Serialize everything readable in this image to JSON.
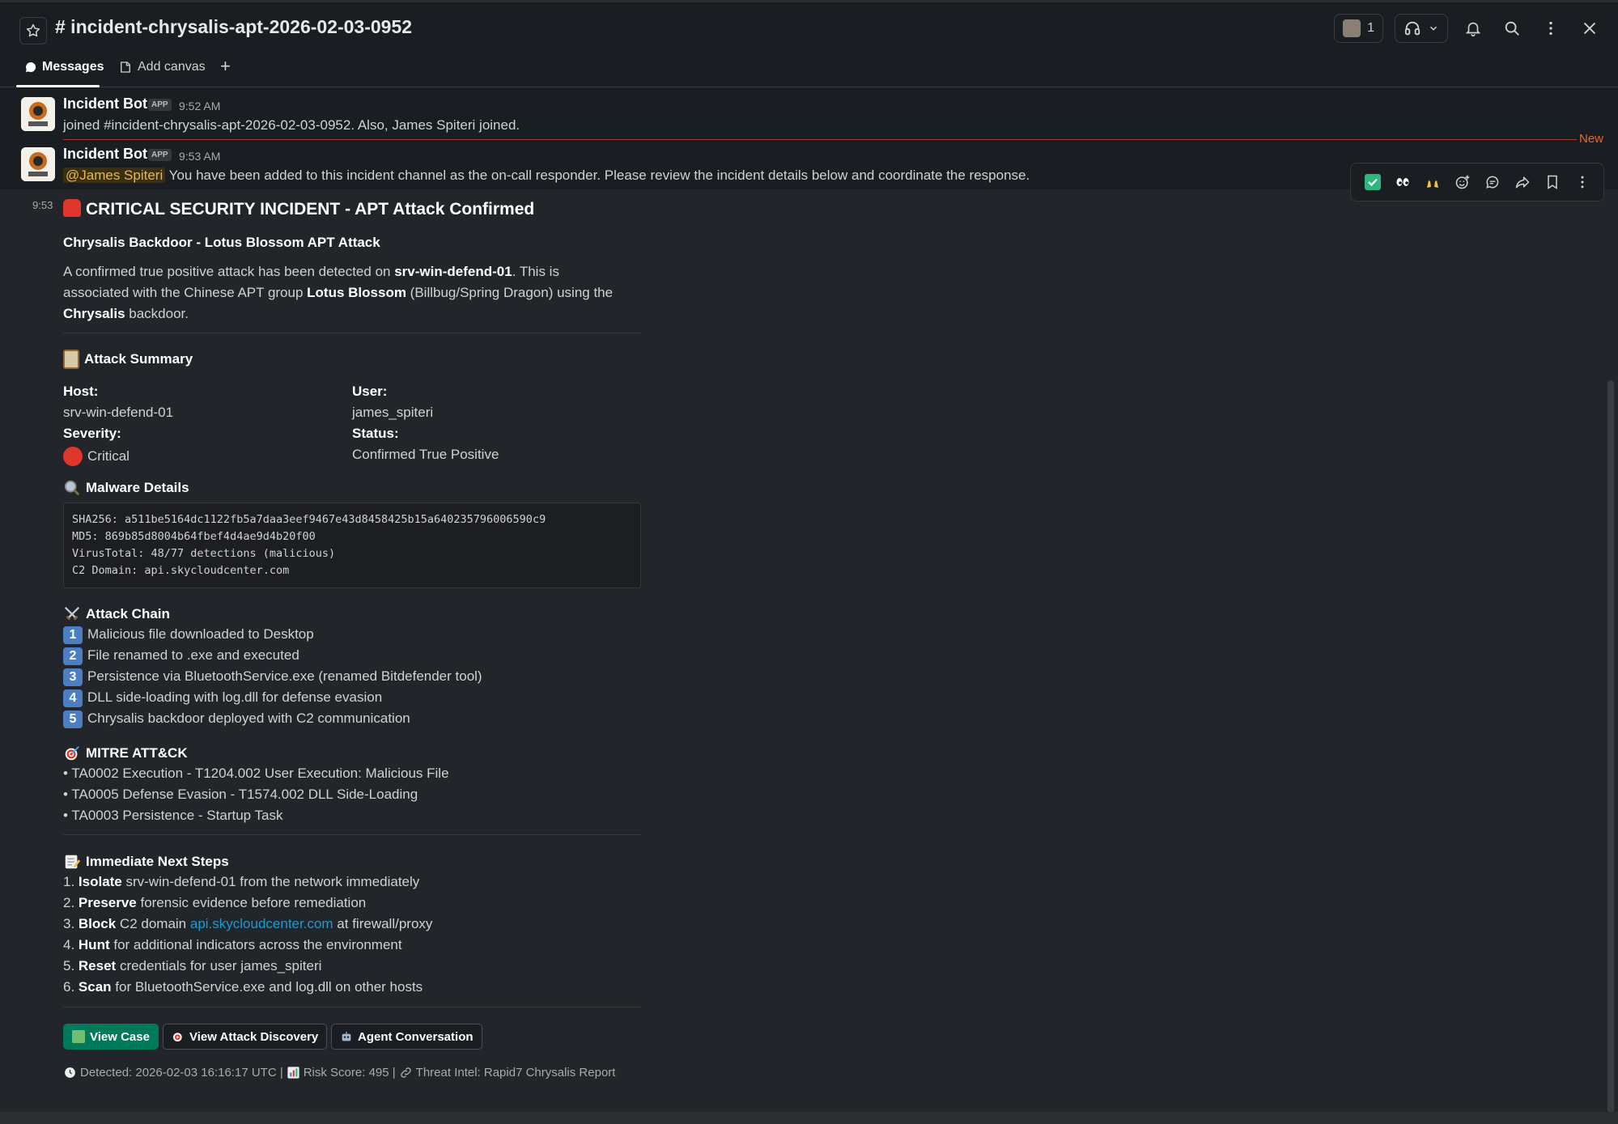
{
  "header": {
    "channel_title": "# incident-chrysalis-apt-2026-02-03-0952",
    "member_count": "1"
  },
  "tabs": {
    "messages": "Messages",
    "add_canvas": "Add canvas",
    "add": "+"
  },
  "messages": [
    {
      "sender": "Incident Bot",
      "badge": "APP",
      "time": "9:52 AM",
      "text": "joined #incident-chrysalis-apt-2026-02-03-0952. Also, James Spiteri joined."
    },
    {
      "sender": "Incident Bot",
      "badge": "APP",
      "time": "9:53 AM",
      "mention": "@James Spiteri",
      "text": " You have been added to this incident channel as the on-call responder. Please review the incident details below and coordinate the response."
    }
  ],
  "new_label": "New",
  "followup_time": "9:53",
  "incident": {
    "title": "CRITICAL SECURITY INCIDENT - APT Attack Confirmed",
    "subtitle": "Chrysalis Backdoor - Lotus Blossom APT Attack",
    "desc_l1_a": "A confirmed true positive attack has been detected on ",
    "desc_l1_b": "srv-win-defend-01",
    "desc_l1_c": ". This is",
    "desc_l2_a": "associated with the Chinese APT group ",
    "desc_l2_b": "Lotus Blossom",
    "desc_l2_c": " (Billbug/Spring Dragon) using the",
    "desc_l3_a": "Chrysalis",
    "desc_l3_b": " backdoor.",
    "summary_title": "Attack Summary",
    "host_label": "Host:",
    "host_value": "srv-win-defend-01",
    "user_label": "User:",
    "user_value": "james_spiteri",
    "severity_label": "Severity:",
    "severity_value": "Critical",
    "status_label": "Status:",
    "status_value": "Confirmed True Positive",
    "malware_title": "Malware Details",
    "code_lines": [
      "SHA256: a511be5164dc1122fb5a7daa3eef9467e43d8458425b15a640235796006590c9",
      "MD5: 869b85d8004b64fbef4d4ae9d4b20f00",
      "VirusTotal: 48/77 detections (malicious)",
      "C2 Domain: api.skycloudcenter.com"
    ],
    "chain_title": "Attack Chain",
    "chain": [
      {
        "num": "1",
        "text": "Malicious file downloaded to Desktop"
      },
      {
        "num": "2",
        "text": "File renamed to .exe and executed"
      },
      {
        "num": "3",
        "text": "Persistence via BluetoothService.exe (renamed Bitdefender tool)"
      },
      {
        "num": "4",
        "text": "DLL side-loading with log.dll for defense evasion"
      },
      {
        "num": "5",
        "text": "Chrysalis backdoor deployed with C2 communication"
      }
    ],
    "mitre_title": "MITRE ATT&CK",
    "mitre": [
      "• TA0002 Execution - T1204.002 User Execution: Malicious File",
      "• TA0005 Defense Evasion - T1574.002 DLL Side-Loading",
      "• TA0003 Persistence - Startup Task"
    ],
    "steps_title": "Immediate Next Steps",
    "steps": [
      {
        "n": "1. ",
        "bold": "Isolate",
        "rest": " srv-win-defend-01 from the network immediately"
      },
      {
        "n": "2. ",
        "bold": "Preserve",
        "rest": " forensic evidence before remediation"
      },
      {
        "n": "3. ",
        "bold": "Block",
        "rest": " C2 domain ",
        "link": "api.skycloudcenter.com",
        "rest2": " at firewall/proxy"
      },
      {
        "n": "4. ",
        "bold": "Hunt",
        "rest": " for additional indicators across the environment"
      },
      {
        "n": "5. ",
        "bold": "Reset",
        "rest": " credentials for user james_spiteri"
      },
      {
        "n": "6. ",
        "bold": "Scan",
        "rest": " for BluetoothService.exe and log.dll on other hosts"
      }
    ],
    "buttons": {
      "view_case": "View Case",
      "view_discovery": "View Attack Discovery",
      "agent_conversation": "Agent Conversation"
    },
    "footer": {
      "detected": "Detected: 2026-02-03 16:16:17 UTC |",
      "risk": "Risk Score: 495 |",
      "intel": "Threat Intel: Rapid7 Chrysalis Report"
    }
  },
  "colors": {
    "accent_green": "#007a5a",
    "new_line": "#e8652f",
    "link": "#1d9bd1"
  }
}
